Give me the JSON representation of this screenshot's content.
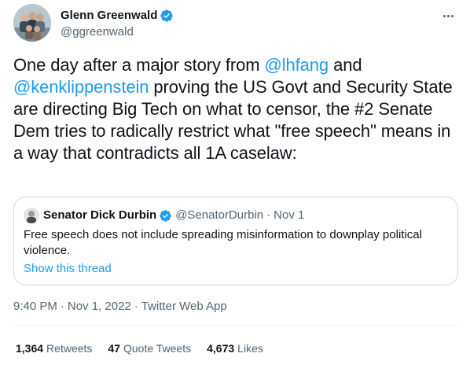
{
  "author": {
    "display_name": "Glenn Greenwald",
    "handle": "@ggreenwald",
    "verified": true,
    "avatar_icon": "group-photo-avatar"
  },
  "tweet": {
    "text_parts": [
      "One day after a major story from ",
      "@lhfang",
      " and ",
      "@kenklippenstein",
      " proving the US Govt and Security State are directing Big Tech on what to censor, the #2 Senate Dem tries to radically restrict what \"free speech\" means in a way that contradicts all 1A caselaw:"
    ]
  },
  "quote": {
    "display_name": "Senator Dick Durbin",
    "handle": "@SenatorDurbin",
    "dot": "·",
    "date": "Nov 1",
    "text": "Free speech does not include spreading misinformation to downplay political violence.",
    "show_thread": "Show this thread"
  },
  "meta": {
    "time": "9:40 PM",
    "sep1": "·",
    "date": "Nov 1, 2022",
    "sep2": "·",
    "source": "Twitter Web App"
  },
  "stats": {
    "retweets_count": "1,364",
    "retweets_label": "Retweets",
    "quotes_count": "47",
    "quotes_label": "Quote Tweets",
    "likes_count": "4,673",
    "likes_label": "Likes"
  },
  "colors": {
    "accent": "#1d9bf0",
    "secondary_text": "#536471",
    "border": "#cfd9de"
  }
}
